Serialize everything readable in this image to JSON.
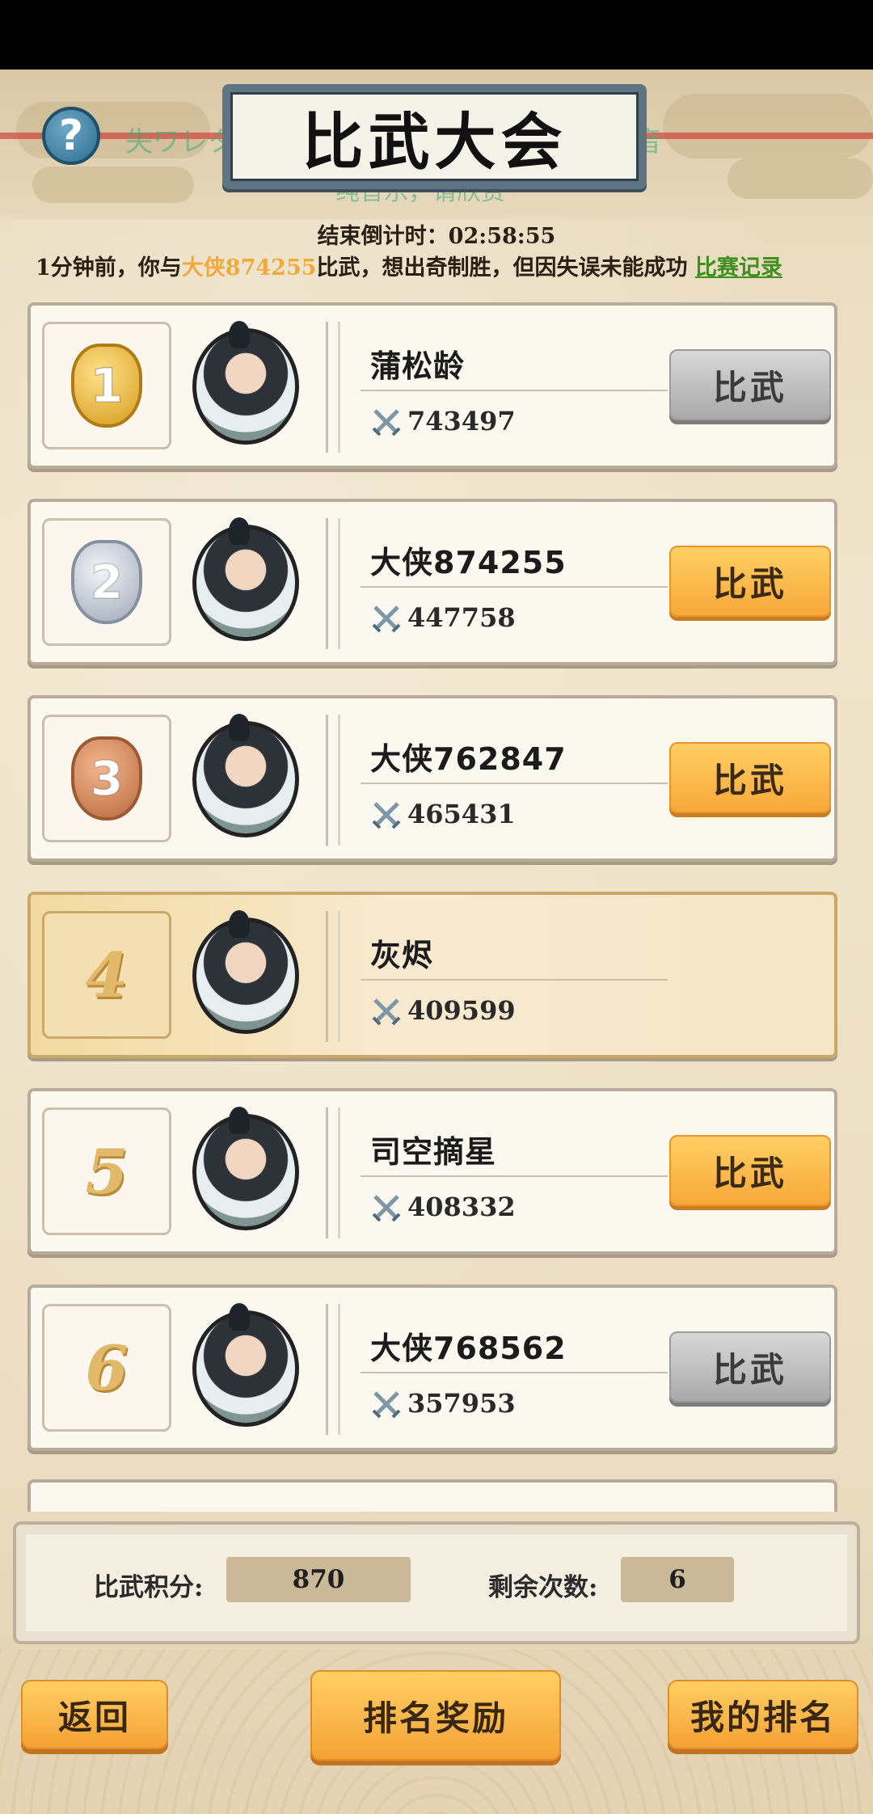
{
  "header": {
    "title": "比武大会",
    "marquee_line1": "失ワレタ森-NO-LOVE 请欣赏 演奏而是美音",
    "marquee_line2": "纯音乐，请欣赏",
    "countdown_label": "结束倒计时：",
    "countdown_value": "02:58:55"
  },
  "notice": {
    "prefix": "1分钟前，你与",
    "opponent": "大侠874255",
    "suffix": "比武，想出奇制胜，但因失误未能成功",
    "link": "比赛记录"
  },
  "rankings": [
    {
      "rank": "1",
      "name": "蒲松龄",
      "power": "743497",
      "button": "比武",
      "button_state": "disabled"
    },
    {
      "rank": "2",
      "name": "大侠874255",
      "power": "447758",
      "button": "比武",
      "button_state": "enabled"
    },
    {
      "rank": "3",
      "name": "大侠762847",
      "power": "465431",
      "button": "比武",
      "button_state": "enabled"
    },
    {
      "rank": "4",
      "name": "灰烬",
      "power": "409599",
      "button": "",
      "button_state": "self"
    },
    {
      "rank": "5",
      "name": "司空摘星",
      "power": "408332",
      "button": "比武",
      "button_state": "enabled"
    },
    {
      "rank": "6",
      "name": "大侠768562",
      "power": "357953",
      "button": "比武",
      "button_state": "disabled"
    }
  ],
  "stats": {
    "score_label": "比武积分:",
    "score_value": "870",
    "remaining_label": "剩余次数:",
    "remaining_value": "6"
  },
  "footer": {
    "back": "返回",
    "rewards": "排名奖励",
    "my_rank": "我的排名"
  },
  "colors": {
    "accent_orange": "#f7a83a",
    "highlight_name": "#f2a93b",
    "link_green": "#3f8e1e"
  }
}
